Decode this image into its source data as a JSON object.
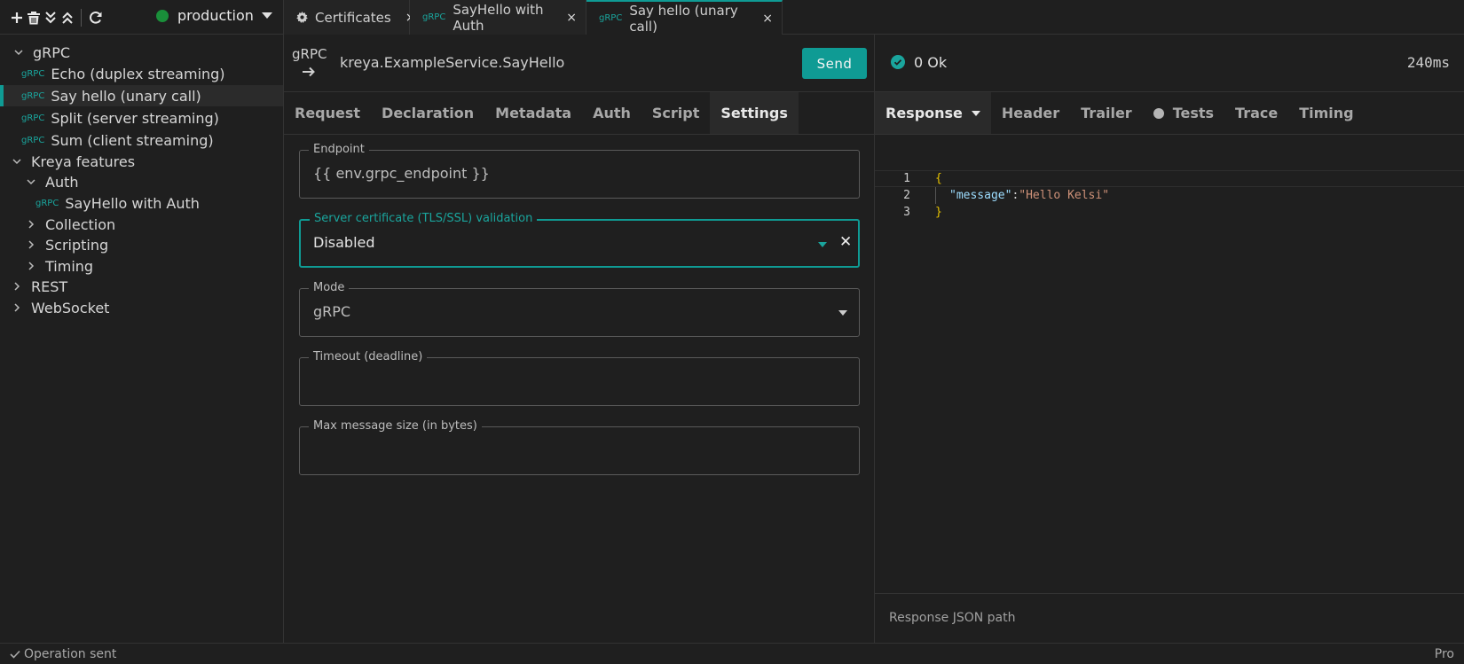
{
  "toolbar": {
    "icons": [
      "plus-icon",
      "trash-icon",
      "collapse-all-icon",
      "expand-all-icon",
      "refresh-icon"
    ],
    "environment": {
      "name": "production",
      "status_color": "#1a8f3a"
    }
  },
  "tabs": [
    {
      "icon": "gear-icon",
      "tag": "",
      "label": "Certificates"
    },
    {
      "icon": "grpc",
      "tag": "gRPC",
      "label": "SayHello with Auth"
    },
    {
      "icon": "grpc",
      "tag": "gRPC",
      "label": "Say hello (unary call)",
      "active": true
    }
  ],
  "tab_close_glyph": "×",
  "sidebar": {
    "items": [
      {
        "label": "gRPC",
        "type": "folder",
        "expanded": true
      },
      {
        "label": "Echo (duplex streaming)",
        "type": "grpc",
        "tag": "gRPC"
      },
      {
        "label": "Say hello (unary call)",
        "type": "grpc",
        "tag": "gRPC",
        "selected": true
      },
      {
        "label": "Split (server streaming)",
        "type": "grpc",
        "tag": "gRPC"
      },
      {
        "label": "Sum (client streaming)",
        "type": "grpc",
        "tag": "gRPC"
      },
      {
        "label": "Kreya features",
        "type": "folder",
        "expanded": true
      },
      {
        "label": "Auth",
        "type": "folder",
        "expanded": true
      },
      {
        "label": "SayHello with Auth",
        "type": "grpc",
        "tag": "gRPC"
      },
      {
        "label": "Collection",
        "type": "folder",
        "expanded": false
      },
      {
        "label": "Scripting",
        "type": "folder",
        "expanded": false
      },
      {
        "label": "Timing",
        "type": "folder",
        "expanded": false
      },
      {
        "label": "REST",
        "type": "folder",
        "expanded": false
      },
      {
        "label": "WebSocket",
        "type": "folder",
        "expanded": false
      }
    ]
  },
  "request": {
    "method": "gRPC",
    "service": "kreya.ExampleService.SayHello",
    "send_label": "Send",
    "tabs": [
      "Request",
      "Declaration",
      "Metadata",
      "Auth",
      "Script",
      "Settings"
    ],
    "active_tab": "Settings"
  },
  "settings": {
    "endpoint": {
      "label": "Endpoint",
      "value": "{{ env.grpc_endpoint }}"
    },
    "certificate": {
      "label": "Server certificate (TLS/SSL) validation",
      "value": "Disabled",
      "clear_glyph": "✕"
    },
    "mode": {
      "label": "Mode",
      "value": "gRPC"
    },
    "timeout": {
      "label": "Timeout (deadline)",
      "value": ""
    },
    "max_size": {
      "label": "Max message size (in bytes)",
      "value": ""
    }
  },
  "response": {
    "status": "0 Ok",
    "time": "240ms",
    "tabs": [
      "Response",
      "Header",
      "Trailer",
      "Tests",
      "Trace",
      "Timing"
    ],
    "active_tab": "Response",
    "code": {
      "line_numbers": [
        "1",
        "2",
        "3"
      ],
      "open": "{",
      "key": "\"message\"",
      "colon": ": ",
      "value": "\"Hello Kelsi\"",
      "close": "}"
    },
    "json_path_placeholder": "Response JSON path"
  },
  "statusbar": {
    "left": "Operation sent",
    "right": "Pro"
  },
  "colors": {
    "accent": "#0f9b94",
    "background": "#1f1f1f"
  }
}
